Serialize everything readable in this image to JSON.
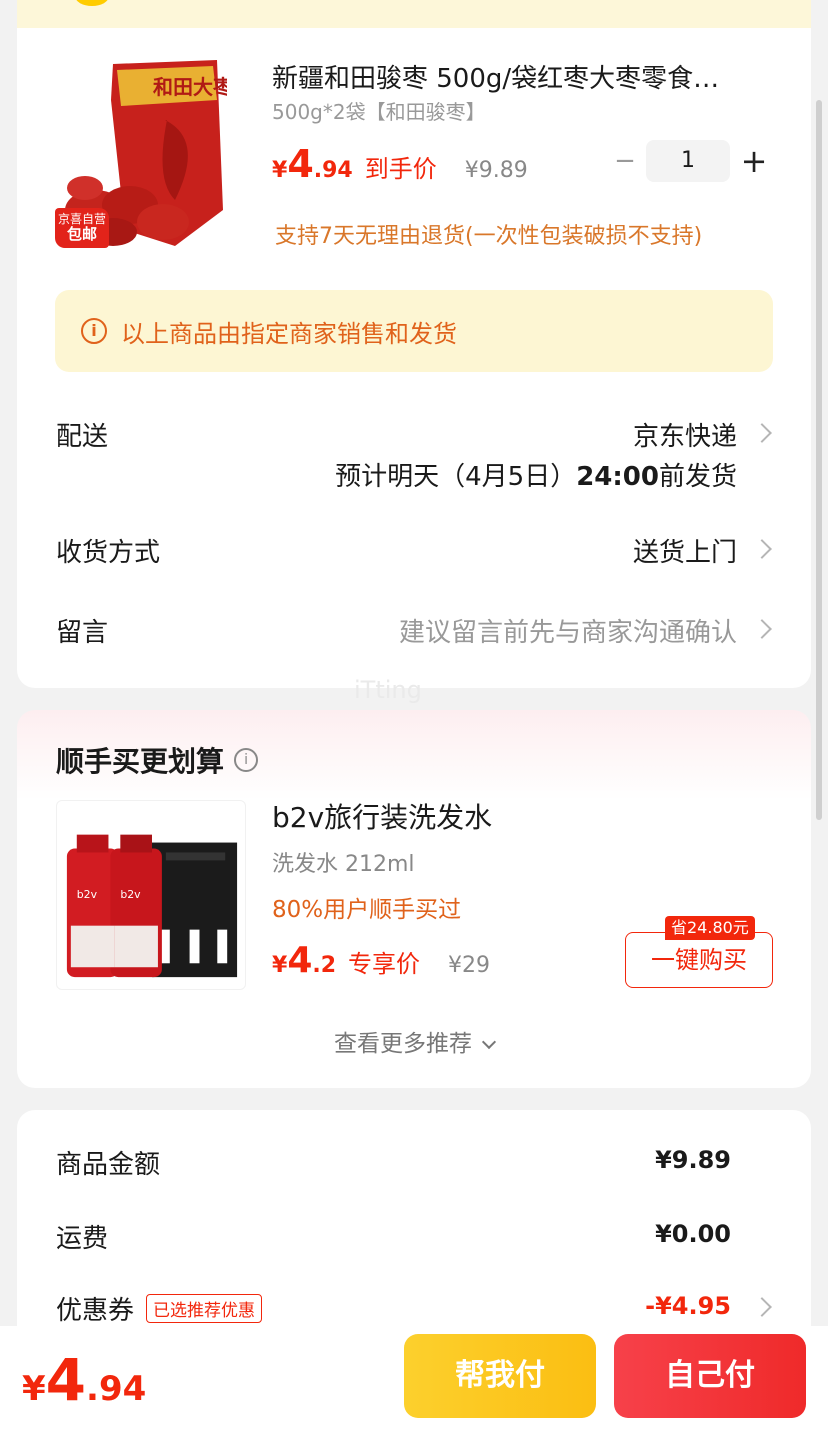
{
  "product": {
    "title": "新疆和田骏枣 500g/袋红枣大枣零食…",
    "spec": "500g*2袋【和田骏枣】",
    "badge_line1": "京喜自营",
    "badge_line2": "包邮",
    "price_yen": "¥",
    "price_int": "4",
    "price_dec": ".94",
    "price_tag": "到手价",
    "orig_price": "¥9.89",
    "quantity": "1",
    "minus": "−",
    "plus": "+",
    "return_note": "支持7天无理由退货(一次性包装破损不支持)",
    "image_text": "和田大枣"
  },
  "notice": {
    "icon": "i",
    "text": "以上商品由指定商家销售和发货"
  },
  "delivery": {
    "label": "配送",
    "value": "京东快递",
    "eta_prefix": "预计明天（4月5日）",
    "eta_time": "24:00",
    "eta_suffix": "前发货"
  },
  "receive": {
    "label": "收货方式",
    "value": "送货上门"
  },
  "message": {
    "label": "留言",
    "placeholder": "建议留言前先与商家沟通确认"
  },
  "watermark": "iTting",
  "recommend": {
    "title": "顺手买更划算",
    "info_icon": "i",
    "name": "b2v旅行装洗发水",
    "spec": "洗发水 212ml",
    "bought": "80%用户顺手买过",
    "price_yen": "¥",
    "price_int": "4",
    "price_dec": ".2",
    "price_tag": "专享价",
    "orig_price": "¥29",
    "save_tag": "省24.80元",
    "buy_button": "一键购买",
    "more": "查看更多推荐",
    "bottle_label": "b2v"
  },
  "summary": {
    "goods_label": "商品金额",
    "goods_value": "¥9.89",
    "freight_label": "运费",
    "freight_value": "¥0.00",
    "coupon_label": "优惠券",
    "coupon_tag": "已选推荐优惠",
    "coupon_value": "-¥4.95"
  },
  "bottom": {
    "total_yen": "¥",
    "total_int": "4",
    "total_dec": ".94",
    "help_pay": "帮我付",
    "self_pay": "自己付"
  },
  "colors": {
    "accent_red": "#f2270c",
    "orange": "#e0621b",
    "yellow_button": "#fbbe12"
  }
}
